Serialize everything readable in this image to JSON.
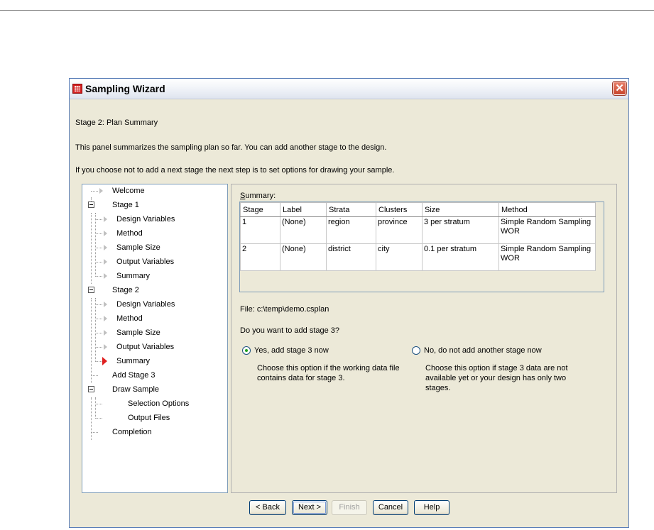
{
  "window": {
    "title": "Sampling Wizard",
    "close_glyph": "✕"
  },
  "content": {
    "stage_heading": "Stage 2: Plan Summary",
    "intro_text": "This panel summarizes the sampling plan so far. You can add another stage to the design.",
    "option_text": "If you choose not to add a next stage the next step is to set options for drawing your sample."
  },
  "tree": [
    {
      "label": "Welcome"
    },
    {
      "label": "Stage 1"
    },
    {
      "label": "Design Variables"
    },
    {
      "label": "Method"
    },
    {
      "label": "Sample Size"
    },
    {
      "label": "Output Variables"
    },
    {
      "label": "Summary"
    },
    {
      "label": "Stage 2"
    },
    {
      "label": "Design Variables"
    },
    {
      "label": "Method"
    },
    {
      "label": "Sample Size"
    },
    {
      "label": "Output Variables"
    },
    {
      "label": "Summary"
    },
    {
      "label": "Add Stage 3"
    },
    {
      "label": "Draw Sample"
    },
    {
      "label": "Selection Options"
    },
    {
      "label": "Output Files"
    },
    {
      "label": "Completion"
    }
  ],
  "summary": {
    "label_first": "S",
    "label_rest": "ummary:",
    "columns": [
      "Stage",
      "Label",
      "Strata",
      "Clusters",
      "Size",
      "Method"
    ],
    "rows": [
      [
        "1",
        "(None)",
        "region",
        "province",
        "3 per stratum",
        "Simple Random Sampling WOR"
      ],
      [
        "2",
        "(None)",
        "district",
        "city",
        "0.1 per stratum",
        "Simple Random Sampling WOR"
      ]
    ]
  },
  "file_line": "File:  c:\\temp\\demo.csplan",
  "add_question": "Do you want to add stage 3?",
  "options": {
    "yes": {
      "label": "Yes, add stage 3 now",
      "desc": "Choose this option if the working data file contains data for stage 3.",
      "selected": true
    },
    "no": {
      "label": "No, do not add another stage now",
      "desc": "Choose this option if stage 3 data are not available yet or your design has only two stages.",
      "selected": false
    }
  },
  "buttons": {
    "back": "< Back",
    "next": "Next >",
    "finish": "Finish",
    "cancel": "Cancel",
    "help": "Help"
  },
  "colors": {
    "active_arrow": "#e02020",
    "selected_radio": "#21a121"
  }
}
